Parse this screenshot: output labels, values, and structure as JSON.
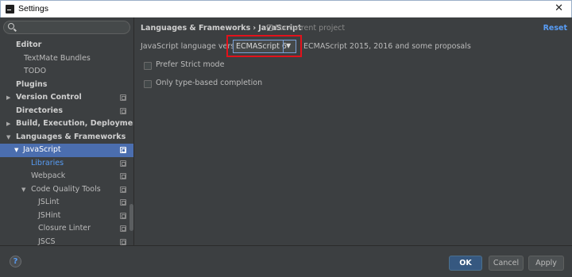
{
  "window": {
    "title": "Settings",
    "close_glyph": "✕"
  },
  "search": {
    "value": "",
    "placeholder": ""
  },
  "tree": {
    "editor": "Editor",
    "textmate": "TextMate Bundles",
    "todo": "TODO",
    "plugins": "Plugins",
    "version_control": "Version Control",
    "directories": "Directories",
    "build": "Build, Execution, Deployment",
    "languages": "Languages & Frameworks",
    "javascript": "JavaScript",
    "libraries": "Libraries",
    "webpack": "Webpack",
    "code_quality": "Code Quality Tools",
    "jslint": "JSLint",
    "jshint": "JSHint",
    "closure": "Closure Linter",
    "jscs": "JSCS"
  },
  "content": {
    "breadcrumb_parent": "Languages & Frameworks",
    "breadcrumb_sep": "›",
    "breadcrumb_current": "JavaScript",
    "scope": "For current project",
    "reset": "Reset",
    "version_label": "JavaScript language version",
    "version_value": "ECMAScript 6",
    "version_desc": "ECMAScript 2015, 2016 and some proposals",
    "prefer_strict": "Prefer Strict mode",
    "type_based": "Only type-based completion"
  },
  "footer": {
    "help": "?",
    "ok": "OK",
    "cancel": "Cancel",
    "apply": "Apply"
  },
  "colors": {
    "background": "#3c3f41",
    "selection": "#4b6eaf",
    "link": "#589df6",
    "highlight": "#e3121b",
    "primary_button": "#365880"
  },
  "icons": [
    "search-icon",
    "chevron-down-icon",
    "copy-icon",
    "help-icon",
    "close-icon",
    "project-scope-icon"
  ]
}
